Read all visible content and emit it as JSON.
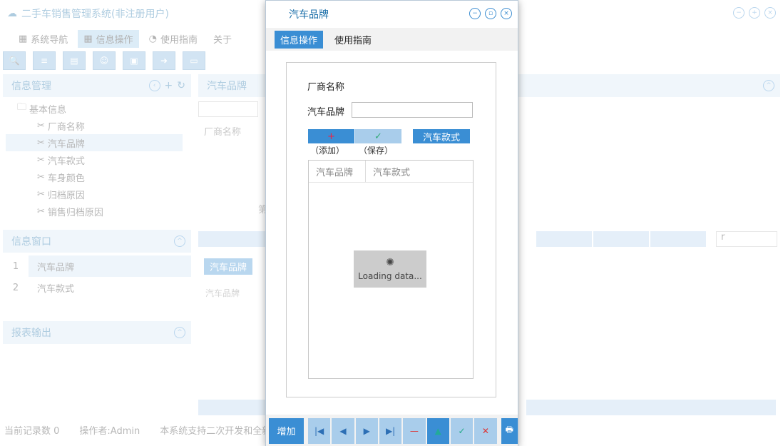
{
  "app": {
    "title": "二手车销售管理系统(非注册用户)"
  },
  "menu": {
    "items": [
      "系统导航",
      "信息操作",
      "使用指南",
      "关于"
    ]
  },
  "sidebar": {
    "info_title": "信息管理",
    "tree_root": "基本信息",
    "tree_items": [
      "厂商名称",
      "汽车品牌",
      "汽车款式",
      "车身颜色",
      "归档原因",
      "销售归档原因"
    ],
    "window_title": "信息窗口",
    "window_rows": [
      {
        "num": "1",
        "label": "汽车品牌"
      },
      {
        "num": "2",
        "label": "汽车款式"
      }
    ],
    "report_title": "报表输出"
  },
  "main": {
    "panel_title": "汽车品牌",
    "col_header": "厂商名称",
    "pager_text": "第",
    "select_value": "r",
    "sub_tab": "汽车品牌",
    "sub_col_header": "汽车品牌"
  },
  "status": {
    "record_count": "当前记录数 0",
    "operator": "操作者:Admin",
    "note": "本系统支持二次开发和全新"
  },
  "modal": {
    "title": "汽车品牌",
    "tabs": [
      "信息操作",
      "使用指南"
    ],
    "form": {
      "vendor_label": "厂商名称",
      "brand_label": "汽车品牌",
      "brand_value": "",
      "add_caption": "（添加）",
      "save_caption": "（保存）",
      "style_button": "汽车款式",
      "grid_headers": [
        "汽车品牌",
        "汽车款式"
      ],
      "loading_text": "Loading data..."
    },
    "footer": {
      "add_label": "增加"
    }
  }
}
